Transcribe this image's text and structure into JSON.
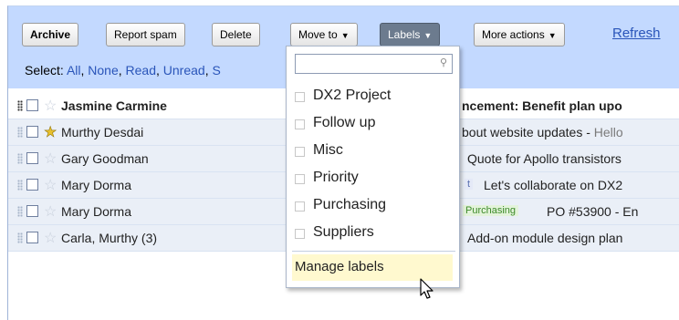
{
  "toolbar": {
    "archive": "Archive",
    "report_spam": "Report spam",
    "delete": "Delete",
    "move_to": "Move to",
    "labels": "Labels",
    "more_actions": "More actions",
    "refresh": "Refresh"
  },
  "select": {
    "label": "Select:",
    "all": "All",
    "none": "None",
    "read": "Read",
    "unread": "Unread",
    "starred": "S"
  },
  "messages": [
    {
      "sender": "Jasmine Carmine",
      "subject": "ncement: Benefit plan upo",
      "snippet": "",
      "tag": "",
      "unread": true,
      "starred": false
    },
    {
      "sender": "Murthy Desdai",
      "subject": "bout website updates - ",
      "snippet": "Hello",
      "tag": "",
      "unread": false,
      "starred": true
    },
    {
      "sender": "Gary Goodman",
      "subject": "Quote for Apollo transistors",
      "snippet": "",
      "tag": "",
      "unread": false,
      "starred": false
    },
    {
      "sender": "Mary Dorma",
      "subject": "Let's collaborate on DX2",
      "snippet": "",
      "tag": "t",
      "unread": false,
      "starred": false
    },
    {
      "sender": "Mary Dorma",
      "subject": "PO #53900 - En",
      "snippet": "",
      "tag": "Purchasing",
      "unread": false,
      "starred": false
    },
    {
      "sender": "Carla, Murthy (3)",
      "subject": "Add-on module design plan",
      "snippet": "",
      "tag": "",
      "unread": false,
      "starred": false
    }
  ],
  "labels_menu": {
    "search_placeholder": "",
    "options": [
      "DX2 Project",
      "Follow up",
      "Misc",
      "Priority",
      "Purchasing",
      "Suppliers"
    ],
    "manage": "Manage labels"
  },
  "icons": {
    "star": "star-icon",
    "search": "search-icon",
    "caret": "caret-down-icon",
    "cursor": "mouse-pointer-icon"
  },
  "colors": {
    "toolbar_bg": "#c3d9ff",
    "link": "#2a55b9",
    "labels_button": "#6c7b8e",
    "manage_highlight": "#fff9cf",
    "tag_green": "#3c8a2a"
  }
}
